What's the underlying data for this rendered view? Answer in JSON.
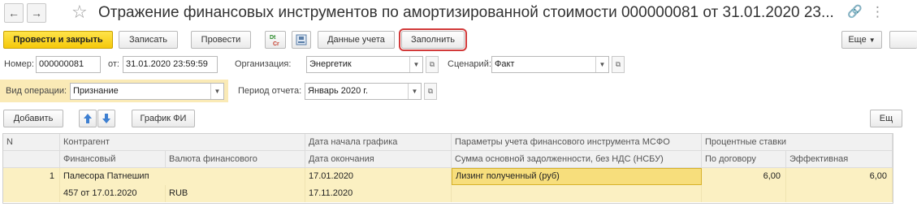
{
  "titlebar": {
    "back_icon": "arrow-left-icon",
    "forward_icon": "arrow-right-icon",
    "favorite_icon": "star-icon",
    "title": "Отражение финансовых инструментов по амортизированной стоимости 000000081 от 31.01.2020 23...",
    "link_icon": "link-icon",
    "menu_icon": "more-vertical-icon"
  },
  "toolbar": {
    "post_and_close": "Провести и закрыть",
    "save": "Записать",
    "post": "Провести",
    "dtkt_label": "Dt Cr",
    "accounting_data": "Данные учета",
    "fill": "Заполнить",
    "more": "Еще"
  },
  "form": {
    "number_label": "Номер:",
    "number_value": "000000081",
    "date_label": "от:",
    "date_value": "31.01.2020 23:59:59",
    "org_label": "Организация:",
    "org_value": "Энергетик",
    "scenario_label": "Сценарий:",
    "scenario_value": "Факт",
    "optype_label": "Вид операции:",
    "optype_value": "Признание",
    "period_label": "Период отчета:",
    "period_value": "Январь 2020 г."
  },
  "table_toolbar": {
    "add": "Добавить",
    "schedule": "График ФИ",
    "more": "Ещ"
  },
  "table": {
    "headers": {
      "n": "N",
      "counterparty": "Контрагент",
      "financial": "Финансовый",
      "currency": "Валюта финансового",
      "schedule_start": "Дата начала графика",
      "end_date": "Дата окончания",
      "ifrs_params": "Параметры учета финансового инструмента МСФО",
      "principal": "Сумма основной задолженности, без НДС (НСБУ)",
      "rates": "Процентные ставки",
      "contract_rate": "По договору",
      "effective_rate": "Эффективная"
    },
    "rows": [
      {
        "n": "1",
        "counterparty": "Палесора Патнешип",
        "financial": "457 от 17.01.2020",
        "currency": "RUB",
        "schedule_start": "17.01.2020",
        "end_date": "17.11.2020",
        "ifrs_params": "Лизинг полученный (руб)",
        "principal": "",
        "contract_rate": "6,00",
        "effective_rate": "6,00"
      }
    ]
  }
}
